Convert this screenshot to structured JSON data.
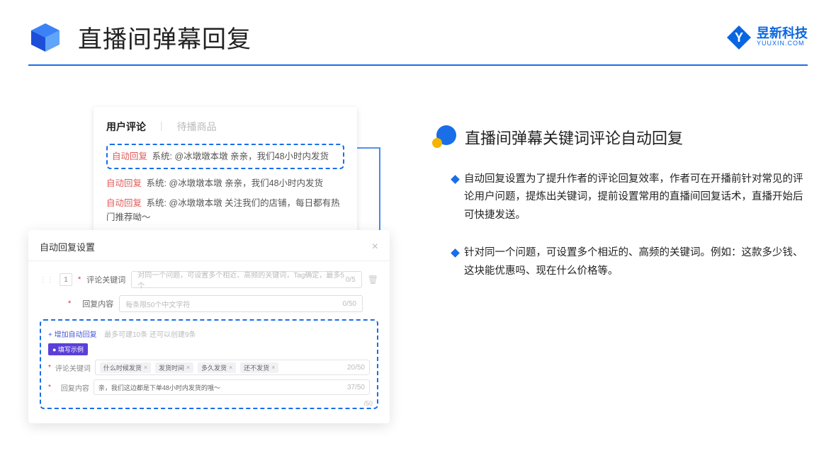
{
  "header": {
    "title": "直播间弹幕回复",
    "brand_name": "昱新科技",
    "brand_sub": "YUUXIN.COM"
  },
  "comments_card": {
    "tab_active": "用户评论",
    "tab_inactive": "待播商品",
    "auto_tag": "自动回复",
    "sys_tag": "系统:",
    "line1": "@冰墩墩本墩 亲亲，我们48小时内发货",
    "line2": "@冰墩墩本墩 亲亲，我们48小时内发货",
    "line3": "@冰墩墩本墩 关注我们的店铺，每日都有热门推荐呦～"
  },
  "settings": {
    "title": "自动回复设置",
    "row_num": "1",
    "kw_label": "评论关键词",
    "kw_placeholder": "对同一个问题，可设置多个相近、高频的关键词，Tag确定，最多5个",
    "kw_counter": "0/5",
    "content_label": "回复内容",
    "content_placeholder": "每条限50个中文字符",
    "content_counter": "0/50",
    "add_link": "+ 增加自动回复",
    "add_hint": "最多可建10条 还可以创建9条",
    "example_badge": "● 填写示例",
    "ex_kw_label": "评论关键词",
    "ex_tags": [
      "什么时候发货",
      "发货时间",
      "多久发货",
      "还不发货"
    ],
    "ex_kw_counter": "20/50",
    "ex_content_label": "回复内容",
    "ex_content_value": "亲，我们这边都是下单48小时内发货的哦～",
    "ex_content_counter": "37/50",
    "scroll_counter": "/50"
  },
  "right": {
    "section_title": "直播间弹幕关键词评论自动回复",
    "bullet1": "自动回复设置为了提升作者的评论回复效率，作者可在开播前针对常见的评论用户问题，提炼出关键词，提前设置常用的直播间回复话术，直播开始后可快捷发送。",
    "bullet2": "针对同一个问题，可设置多个相近的、高频的关键词。例如：这款多少钱、这块能优惠吗、现在什么价格等。"
  }
}
